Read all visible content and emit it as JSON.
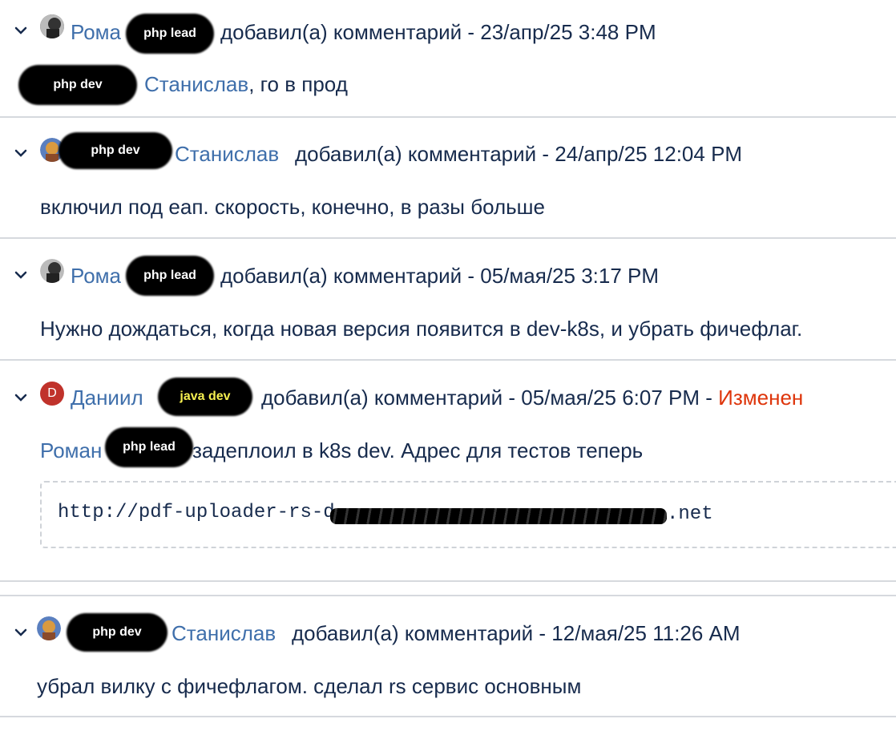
{
  "comments": [
    {
      "author": "Рома",
      "role_tag": "php lead",
      "meta": "добавил(а) комментарий - 23/апр/25 3:48 PM",
      "body_tag": "php dev",
      "body_mention": "Станислав",
      "body_text": ", го в прод"
    },
    {
      "role_tag": "php dev",
      "author": "Станислав",
      "meta": "добавил(а) комментарий - 24/апр/25 12:04 PM",
      "body_text": "включил под еап. скорость, конечно, в разы больше"
    },
    {
      "author": "Рома",
      "role_tag": "php lead",
      "meta": "добавил(а) комментарий - 05/мая/25 3:17 PM",
      "body_text": "Нужно дождаться, когда новая версия появится в dev-k8s, и убрать фичефлаг."
    },
    {
      "avatar_letter": "D",
      "author": "Даниил",
      "role_tag": "java dev",
      "meta": "добавил(а) комментарий - 05/мая/25 6:07 PM -",
      "edited": "Изменен",
      "body_mention": "Роман",
      "body_tag": "php lead",
      "body_text": "задеплоил в k8s dev. Адрес для тестов теперь",
      "code": "http://pdf-uploader-rs-d",
      "code_end": ".net"
    },
    {
      "role_tag": "php dev",
      "author": "Станислав",
      "meta": "добавил(а) комментарий - 12/мая/25 11:26 AM",
      "body_text": "убрал вилку с фичефлагом. сделал rs сервис основным"
    }
  ],
  "colors": {
    "link": "#3f6fab",
    "text": "#172b4d",
    "edited": "#de350b",
    "separator": "#d6d9de"
  },
  "icons": {
    "chevron": "chevron-down-icon",
    "avatar": "user-avatar"
  }
}
